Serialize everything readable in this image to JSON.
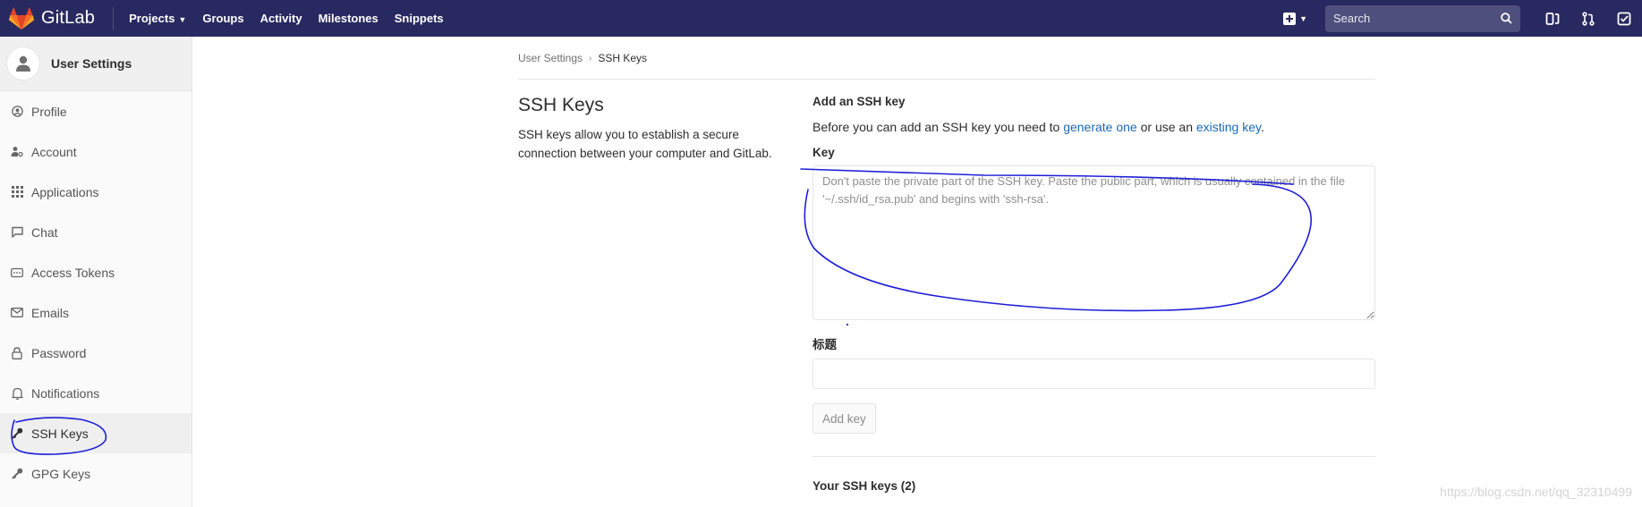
{
  "navbar": {
    "brand": "GitLab",
    "links": {
      "projects": "Projects",
      "groups": "Groups",
      "activity": "Activity",
      "milestones": "Milestones",
      "snippets": "Snippets"
    },
    "search_placeholder": "Search",
    "colors": {
      "background": "#292961",
      "logo": "#fc6d26"
    }
  },
  "sidebar": {
    "title": "User Settings",
    "items": [
      {
        "label": "Profile",
        "icon": "profile-icon"
      },
      {
        "label": "Account",
        "icon": "account-icon"
      },
      {
        "label": "Applications",
        "icon": "applications-icon"
      },
      {
        "label": "Chat",
        "icon": "chat-icon"
      },
      {
        "label": "Access Tokens",
        "icon": "token-icon"
      },
      {
        "label": "Emails",
        "icon": "email-icon"
      },
      {
        "label": "Password",
        "icon": "lock-icon"
      },
      {
        "label": "Notifications",
        "icon": "bell-icon"
      },
      {
        "label": "SSH Keys",
        "icon": "key-icon",
        "active": true
      },
      {
        "label": "GPG Keys",
        "icon": "key-icon"
      }
    ]
  },
  "breadcrumb": {
    "parent": "User Settings",
    "current": "SSH Keys"
  },
  "page": {
    "title": "SSH Keys",
    "description": "SSH keys allow you to establish a secure connection between your computer and GitLab."
  },
  "form": {
    "section_title": "Add an SSH key",
    "intro_prefix": "Before you can add an SSH key you need to ",
    "generate_link": "generate one",
    "intro_middle": " or use an ",
    "existing_link": "existing key",
    "intro_suffix": ".",
    "key_label": "Key",
    "key_placeholder": "Don't paste the private part of the SSH key. Paste the public part, which is usually contained in the file '~/.ssh/id_rsa.pub' and begins with 'ssh-rsa'.",
    "title_label": "标题",
    "title_value": "",
    "add_button": "Add key",
    "your_keys_heading": "Your SSH keys (2)"
  },
  "watermark": "https://blog.csdn.net/qq_32310499",
  "annotation_color": "#1e1ed8"
}
